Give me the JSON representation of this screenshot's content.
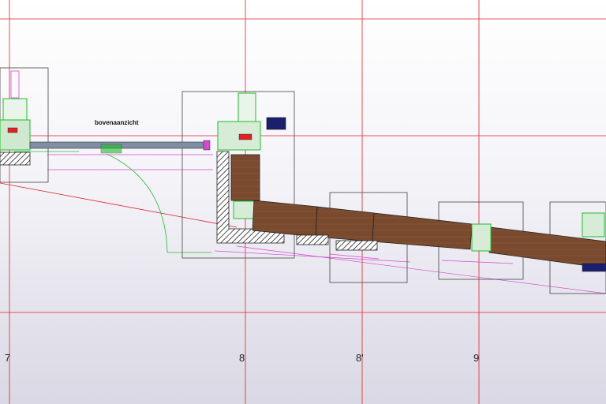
{
  "drawing": {
    "view_title": "bovenaanzicht",
    "grid_axes": [
      "7",
      "8",
      "8'",
      "9"
    ]
  },
  "colors": {
    "grid_line": "#e0202a",
    "outline": "#444444",
    "wall_fill": "#7a4a2f",
    "green_lines": "#1fbf2a",
    "magenta_lines": "#d24bd2",
    "motor_blue": "#1a1f6e",
    "glass": "#7f8ea3"
  }
}
